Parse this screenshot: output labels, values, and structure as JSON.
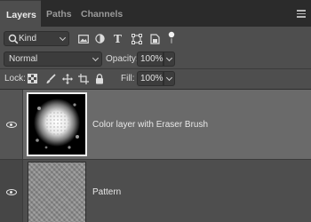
{
  "tabs": [
    {
      "label": "Layers",
      "active": true
    },
    {
      "label": "Paths",
      "active": false
    },
    {
      "label": "Channels",
      "active": false
    }
  ],
  "filter": {
    "kind_label": "Kind",
    "icons": [
      "image-filter-icon",
      "adjustment-filter-icon",
      "type-filter-icon",
      "shape-filter-icon",
      "smart-object-filter-icon",
      "filter-toggle-icon"
    ]
  },
  "blend": {
    "mode": "Normal",
    "opacity_label": "Opacity:",
    "opacity_value": "100%"
  },
  "lock": {
    "label": "Lock:",
    "icons": [
      "lock-transparent-pixels-icon",
      "lock-image-pixels-icon",
      "lock-position-icon",
      "lock-artboard-icon",
      "lock-all-icon"
    ],
    "fill_label": "Fill:",
    "fill_value": "100%"
  },
  "layers": [
    {
      "name": "Color layer with Eraser Brush",
      "visible": true,
      "selected": true
    },
    {
      "name": "Pattern",
      "visible": true,
      "selected": false
    }
  ],
  "colors": {
    "panel_bg": "#4e4e4e",
    "tabbar_bg": "#2b2b2b",
    "selected_layer": "#6a6a6a",
    "field_bg": "#3c3c3c"
  }
}
